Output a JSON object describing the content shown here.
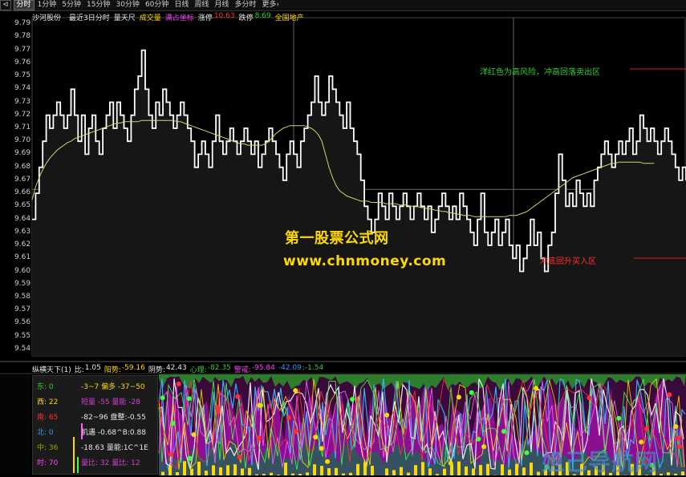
{
  "tabs": {
    "ctrl": "⊲",
    "items": [
      "分时",
      "1分钟",
      "5分钟",
      "15分钟",
      "30分钟",
      "60分钟",
      "日线",
      "周线",
      "月线",
      "多分时",
      "更多"
    ],
    "more_suffix": "›"
  },
  "info": {
    "stock_name": "沙河股份",
    "mode": "最近3日分时",
    "tool": "量天尺",
    "volume_label": "成交量",
    "coord_label": "满占坐标",
    "limit_up_label": "涨停",
    "limit_up_value": "10.63",
    "limit_down_label": "跌停",
    "limit_down_value": "8.69",
    "sector": "全国地产"
  },
  "y_axis_labels": [
    "9.79",
    "9.78",
    "9.77",
    "9.76",
    "9.75",
    "9.74",
    "9.73",
    "9.72",
    "9.71",
    "9.70",
    "9.69",
    "9.68",
    "9.67",
    "9.66",
    "9.65",
    "9.64",
    "9.63",
    "9.62",
    "9.61",
    "9.60",
    "9.59",
    "9.58",
    "9.57",
    "9.56",
    "9.55",
    "9.54"
  ],
  "watermark": {
    "line1": "第一股票公式网",
    "line2": "www.chnmoney.com",
    "bottom": "姐己导航网"
  },
  "annotations": {
    "top_right": "洋红色为高风险，冲高回落卖出区",
    "bottom_right": "冲底回升买入区"
  },
  "indicator_bar": {
    "name": "纵横天下(1)",
    "ratio_label": "比:",
    "ratio_value": "1.05",
    "yang_label": "阳势:",
    "yang_value": "-59.16",
    "yin_label": "阴势:",
    "yin_value": "42.43",
    "heart_label": "心理:",
    "heart_value": "-82.35",
    "caution_label": "警戒:",
    "caution_value": "-95.84",
    "extra1": "-42.09",
    "extra2": ":-1.54"
  },
  "left_panel": {
    "rows": [
      {
        "a": "东: 0",
        "b": "-3~7 偏多 -37~50",
        "ca": "#33cc33",
        "cb": "#ffd800"
      },
      {
        "a": "西: 22",
        "b": "短量 -55 量能 -28",
        "ca": "#ffd800",
        "cb": "#d040d0"
      },
      {
        "a": "南: 65",
        "b": "-82~96 盘整:-0.55",
        "ca": "#ff3030",
        "cb": "#e8e8e8"
      },
      {
        "a": "北: 0",
        "b": "机遇 -0.68^B:0.88",
        "ca": "#3399ff",
        "cb": "#e8e8e8"
      },
      {
        "a": "中: 36",
        "b": "-18.63 量能:1C^1E",
        "ca": "#a0a000",
        "cb": "#e8e8e8"
      },
      {
        "a": "时: 70",
        "b": "量比: 32 量比: 12",
        "ca": "#ff40ff",
        "cb": "#d040d0"
      }
    ]
  },
  "chart_data": {
    "type": "line",
    "title": "",
    "xlabel": "",
    "ylabel": "",
    "ylim": [
      9.535,
      9.795
    ],
    "series": [
      {
        "values": [
          9.64,
          9.66,
          9.68,
          9.7,
          9.72,
          9.71,
          9.72,
          9.73,
          9.72,
          9.71,
          9.72,
          9.74,
          9.72,
          9.7,
          9.72,
          9.69,
          9.71,
          9.72,
          9.7,
          9.69,
          9.71,
          9.72,
          9.73,
          9.71,
          9.73,
          9.72,
          9.71,
          9.7,
          9.72,
          9.74,
          9.75,
          9.77,
          9.74,
          9.72,
          9.71,
          9.73,
          9.72,
          9.74,
          9.73,
          9.72,
          9.71,
          9.72,
          9.73,
          9.72,
          9.71,
          9.7,
          9.68,
          9.69,
          9.7,
          9.69,
          9.68,
          9.7,
          9.72,
          9.7,
          9.69,
          9.7,
          9.71,
          9.7,
          9.69,
          9.7,
          9.71,
          9.7,
          9.69,
          9.7,
          9.68,
          9.69,
          9.7,
          9.71,
          9.7,
          9.69,
          9.68,
          9.67,
          9.69,
          9.7,
          9.69,
          9.68,
          9.7,
          9.71,
          9.72,
          9.73,
          9.75,
          9.73,
          9.72,
          9.73,
          9.75,
          9.74,
          9.73,
          9.72,
          9.71,
          9.73,
          9.71,
          9.7,
          9.69,
          9.67,
          9.65,
          9.64,
          9.63,
          9.64,
          9.66,
          9.65,
          9.64,
          9.66,
          9.65,
          9.64,
          9.65,
          9.66,
          9.65,
          9.64,
          9.65,
          9.66,
          9.65,
          9.64,
          9.65,
          9.63,
          9.64,
          9.65,
          9.66,
          9.65,
          9.64,
          9.65,
          9.64,
          9.66,
          9.65,
          9.64,
          9.63,
          9.62,
          9.64,
          9.66,
          9.63,
          9.62,
          9.63,
          9.64,
          9.62,
          9.63,
          9.64,
          9.62,
          9.61,
          9.62,
          9.6,
          9.61,
          9.62,
          9.64,
          9.62,
          9.63,
          9.61,
          9.6,
          9.62,
          9.63,
          9.66,
          9.69,
          9.67,
          9.65,
          9.66,
          9.65,
          9.67,
          9.66,
          9.65,
          9.66,
          9.65,
          9.67,
          9.68,
          9.69,
          9.7,
          9.69,
          9.68,
          9.69,
          9.7,
          9.69,
          9.7,
          9.71,
          9.69,
          9.7,
          9.72,
          9.71,
          9.7,
          9.71,
          9.7,
          9.69,
          9.7,
          9.71,
          9.7,
          9.69,
          9.68,
          9.67,
          9.68,
          9.67
        ]
      },
      {
        "values": [
          9.655,
          9.665,
          9.672,
          9.678,
          9.683,
          9.687,
          9.69,
          9.693,
          9.695,
          9.697,
          9.699,
          9.7,
          9.702,
          9.703,
          9.704,
          9.705,
          9.706,
          9.707,
          9.708,
          9.709,
          9.71,
          9.711,
          9.712,
          9.713,
          9.714,
          9.714,
          9.715,
          9.715,
          9.715,
          9.715,
          9.715,
          9.716,
          9.716,
          9.716,
          9.716,
          9.716,
          9.716,
          9.716,
          9.716,
          9.716,
          9.716,
          9.715,
          9.715,
          9.714,
          9.713,
          9.712,
          9.711,
          9.71,
          9.709,
          9.708,
          9.707,
          9.706,
          9.705,
          9.704,
          9.703,
          9.702,
          9.701,
          9.7,
          9.699,
          9.698,
          9.698,
          9.697,
          9.697,
          9.697,
          9.697,
          9.697,
          9.698,
          9.7,
          9.703,
          9.706,
          9.708,
          9.71,
          9.711,
          9.712,
          9.712,
          9.712,
          9.712,
          9.712,
          9.711,
          9.71,
          9.708,
          9.705,
          9.7,
          9.69,
          9.68,
          9.672,
          9.666,
          9.662,
          9.66,
          9.658,
          9.657,
          9.656,
          9.655,
          9.654,
          9.654,
          9.654,
          9.653,
          9.653,
          9.653,
          9.653,
          9.652,
          9.652,
          9.652,
          9.652,
          9.651,
          9.651,
          9.651,
          9.65,
          9.65,
          9.65,
          9.649,
          9.649,
          9.648,
          9.648,
          9.647,
          9.647,
          9.646,
          9.646,
          9.645,
          9.645,
          9.644,
          9.644,
          9.643,
          9.643,
          9.643,
          9.642,
          9.642,
          9.642,
          9.642,
          9.642,
          9.642,
          9.642,
          9.642,
          9.642,
          9.642,
          9.643,
          9.643,
          9.643,
          9.644,
          9.645,
          9.646,
          9.648,
          9.65,
          9.652,
          9.654,
          9.656,
          9.658,
          9.66,
          9.662,
          9.664,
          9.666,
          9.668,
          9.67,
          9.672,
          9.673,
          9.674,
          9.675,
          9.676,
          9.677,
          9.678,
          9.679,
          9.68,
          9.681,
          9.682,
          9.683,
          9.683,
          9.684,
          9.684,
          9.684,
          9.684,
          9.684,
          9.684,
          9.684,
          9.683,
          9.683,
          9.683,
          9.683
        ]
      }
    ]
  },
  "colors": {
    "background": "#000000",
    "price_line": "#ffffff",
    "avg_line": "#d8d070",
    "grid": "#555555",
    "watermark": "#ffd800",
    "magenta": "#e000e0",
    "green_text": "#33cc33",
    "red_text": "#ff3030"
  }
}
